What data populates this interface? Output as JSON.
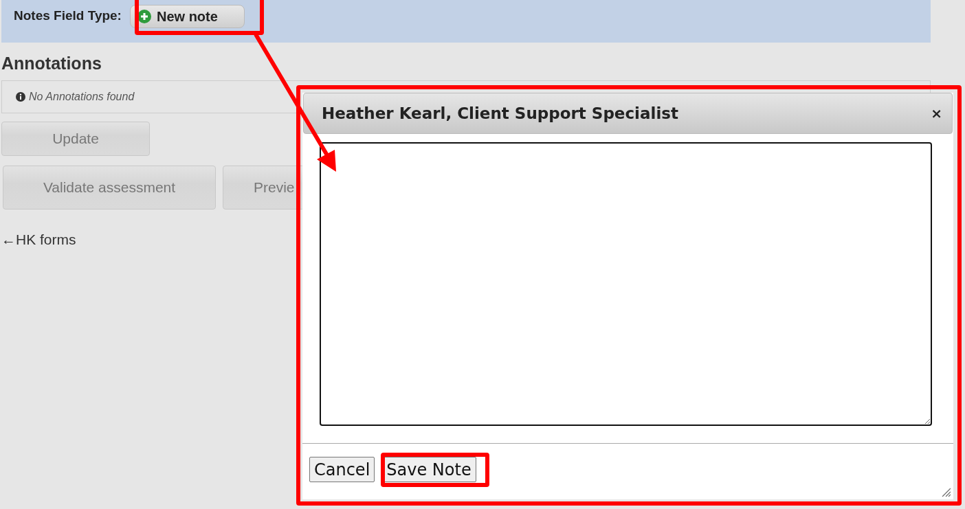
{
  "header": {
    "label": "Notes Field Type:",
    "new_note_button": "New note"
  },
  "annotations": {
    "title": "Annotations",
    "empty_message": "No Annotations found"
  },
  "update_button": "Update",
  "action_buttons": [
    "Validate assessment",
    "Previe"
  ],
  "back_link": "←HK forms",
  "dialog": {
    "title": "Heather Kearl, Client Support Specialist",
    "close": "×",
    "buttons": [
      "Cancel",
      "Save Note"
    ]
  }
}
